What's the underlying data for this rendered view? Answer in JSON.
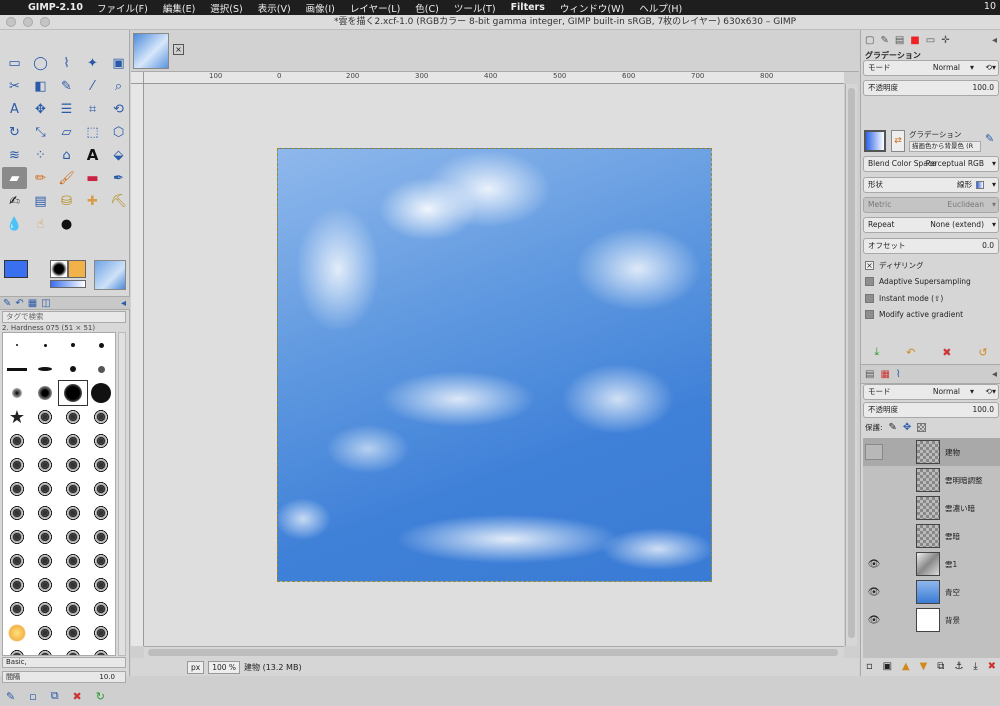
{
  "menubar": {
    "apple": "",
    "app": "GIMP-2.10",
    "items": [
      "ファイル(F)",
      "編集(E)",
      "選択(S)",
      "表示(V)",
      "画像(I)",
      "レイヤー(L)",
      "色(C)",
      "ツール(T)",
      "Filters",
      "ウィンドウ(W)",
      "ヘルプ(H)"
    ],
    "clock": "10"
  },
  "window_title": "*雲を描く2.xcf-1.0 (RGBカラー 8-bit gamma integer, GIMP built-in sRGB, 7枚のレイヤー) 630x630 – GIMP",
  "toolbox": {
    "tag_search_placeholder": "タグで検索",
    "brush_name": "2. Hardness 075 (51 × 51)",
    "brush_set": "Basic,",
    "spacing_label": "間隔",
    "spacing_value": "10.0"
  },
  "ruler": {
    "ticks": [
      "0",
      "100",
      "200",
      "300",
      "400",
      "500",
      "600",
      "700",
      "800"
    ]
  },
  "statusbar": {
    "unit": "px",
    "zoom": "100 %",
    "info": "建物 (13.2 MB)"
  },
  "gradient_panel": {
    "title": "グラデーション",
    "mode_label": "モード",
    "mode_value": "Normal",
    "opacity_label": "不透明度",
    "opacity_value": "100.0",
    "gradient_label": "グラデーション",
    "gradient_value": "描画色から背景色 (R",
    "blend_label": "Blend Color Space",
    "blend_value": "Perceptual RGB",
    "shape_label": "形状",
    "shape_value": "線形",
    "metric_label": "Metric",
    "metric_value": "Euclidean",
    "repeat_label": "Repeat",
    "repeat_value": "None (extend)",
    "offset_label": "オフセット",
    "offset_value": "0.0",
    "dither_label": "ディザリング",
    "adaptive_label": "Adaptive Supersampling",
    "instant_label": "Instant mode (⇧)",
    "modify_label": "Modify active gradient"
  },
  "layers_panel": {
    "mode_label": "モード",
    "mode_value": "Normal",
    "opacity_label": "不透明度",
    "opacity_value": "100.0",
    "lock_label": "保護:",
    "layers": [
      {
        "name": "建物",
        "visible": false,
        "selected": true
      },
      {
        "name": "雲明暗調整",
        "visible": false,
        "selected": false
      },
      {
        "name": "雲濃い暗",
        "visible": false,
        "selected": false
      },
      {
        "name": "雲暗",
        "visible": false,
        "selected": false
      },
      {
        "name": "雲1",
        "visible": true,
        "selected": false
      },
      {
        "name": "青空",
        "visible": true,
        "selected": false
      },
      {
        "name": "背景",
        "visible": true,
        "selected": false
      }
    ]
  },
  "colors": {
    "foreground": "#3a6ff0",
    "background": "#ffffff",
    "sky": "#3a7bd5"
  }
}
